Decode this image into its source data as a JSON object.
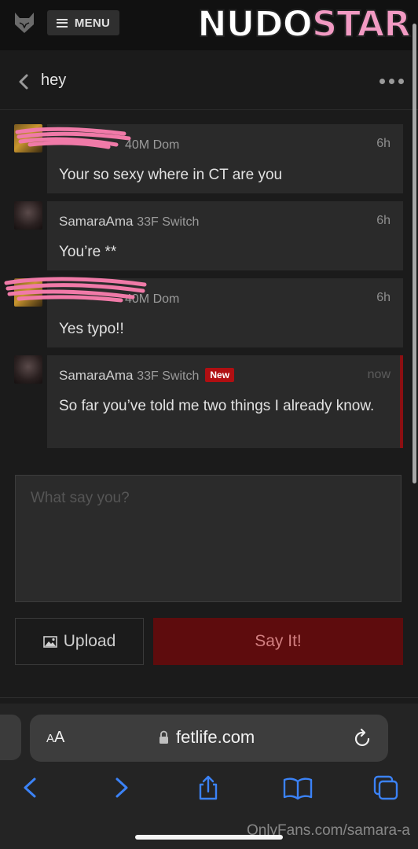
{
  "header": {
    "menu_label": "MENU",
    "logo_part1": "NUDO",
    "logo_part2": "STAR"
  },
  "conversation": {
    "title": "hey"
  },
  "messages": [
    {
      "name": "",
      "sub": "40M Dom",
      "time": "6h",
      "body": "Your so sexy where in CT are you",
      "is_new": false
    },
    {
      "name": "SamaraAma",
      "sub": "33F Switch",
      "time": "6h",
      "body": "You’re **",
      "is_new": false
    },
    {
      "name": "",
      "sub": "40M Dom",
      "time": "6h",
      "body": "Yes typo!!",
      "is_new": false
    },
    {
      "name": "SamaraAma",
      "sub": "33F Switch",
      "time": "now",
      "body": "So far you’ve told me two things I already know.",
      "is_new": true,
      "badge": "New"
    }
  ],
  "reply": {
    "placeholder": "What say you?",
    "upload_label": "Upload",
    "send_label": "Say It!"
  },
  "browser": {
    "text_size_label_small": "A",
    "text_size_label_large": "A",
    "url": "fetlife.com"
  },
  "watermark": "OnlyFans.com/samara-a",
  "colors": {
    "accent": "#5e0c0d",
    "new_badge": "#b00f12",
    "logo_pink": "#f29ac3"
  }
}
